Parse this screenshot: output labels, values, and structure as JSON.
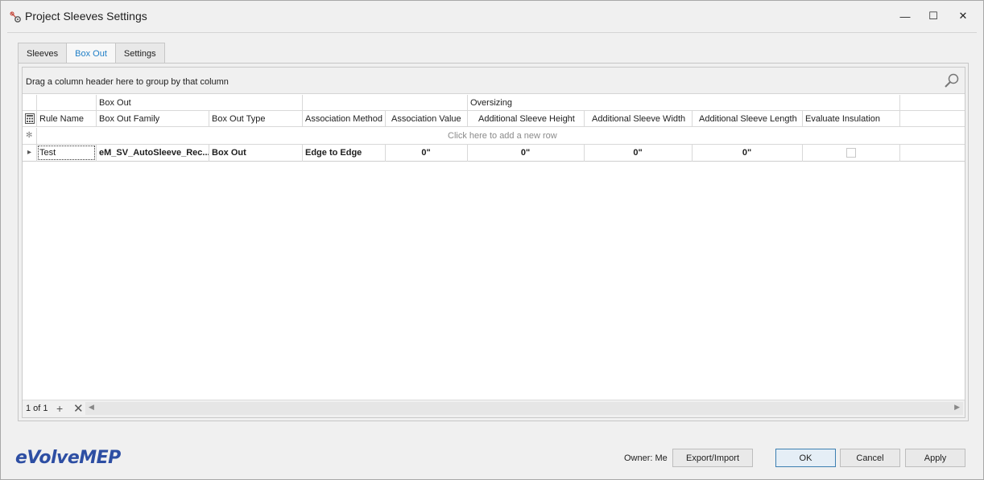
{
  "window": {
    "title": "Project Sleeves Settings",
    "controls": {
      "minimize": "—",
      "maximize": "☐",
      "close": "✕"
    }
  },
  "tabs": [
    {
      "label": "Sleeves",
      "active": false
    },
    {
      "label": "Box Out",
      "active": true
    },
    {
      "label": "Settings",
      "active": false
    }
  ],
  "grid": {
    "group_hint": "Drag a column header here to group by that column",
    "bands": {
      "box_out": "Box Out",
      "oversizing": "Oversizing"
    },
    "columns": [
      "Rule Name",
      "Box Out Family",
      "Box Out Type",
      "Association Method",
      "Association Value",
      "Additional Sleeve Height",
      "Additional Sleeve Width",
      "Additional Sleeve Length",
      "Evaluate Insulation"
    ],
    "new_row_hint": "Click here to add a new row",
    "new_row_marker": "✻",
    "row_indicator": "▸",
    "rows": [
      {
        "rule_name": "Test",
        "box_out_family": "eM_SV_AutoSleeve_Rec...",
        "box_out_type": "Box Out",
        "association_method": "Edge to Edge",
        "association_value": "0\"",
        "add_height": "0\"",
        "add_width": "0\"",
        "add_length": "0\"",
        "evaluate_insulation": false
      }
    ],
    "pager": "1 of 1",
    "nav_add": "+",
    "nav_delete": "✕"
  },
  "footer": {
    "brand": "eVolveMEP",
    "owner": "Owner: Me",
    "export_import": "Export/Import",
    "ok": "OK",
    "cancel": "Cancel",
    "apply": "Apply"
  },
  "colors": {
    "active_tab_text": "#1f7fc7",
    "brand": "#2d4ea3",
    "ok_border": "#3c7fb1"
  }
}
